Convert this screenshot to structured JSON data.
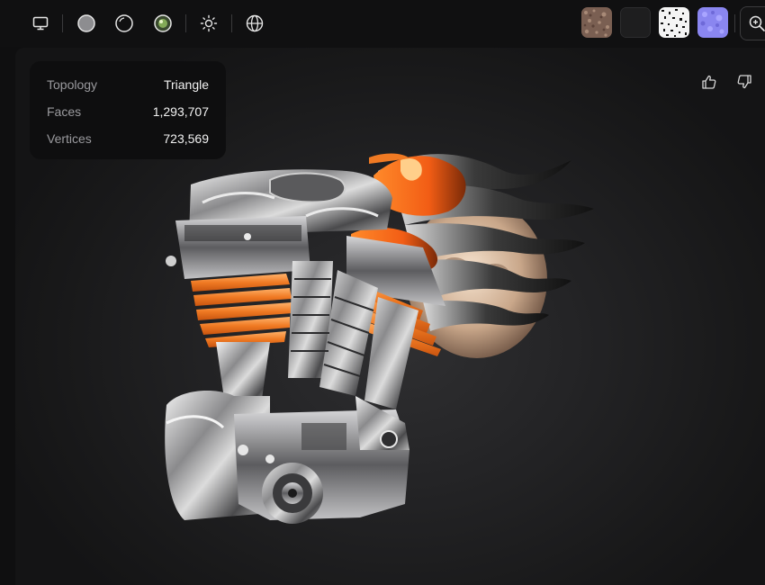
{
  "toolbar": {
    "buttons": [
      {
        "name": "display-mode-button",
        "icon": "monitor-icon"
      },
      {
        "name": "solid-material-button",
        "icon": "filled-sphere-icon"
      },
      {
        "name": "wireframe-material-button",
        "icon": "outline-sphere-icon"
      },
      {
        "name": "clay-material-button",
        "icon": "green-sphere-icon"
      },
      {
        "name": "lighting-button",
        "icon": "sun-icon"
      },
      {
        "name": "environment-button",
        "icon": "globe-icon"
      }
    ],
    "texture_maps": [
      {
        "name": "base-color-texture-thumbnail",
        "icon": "base-color-icon"
      },
      {
        "name": "roughness-texture-thumbnail",
        "icon": "dark-map-icon"
      },
      {
        "name": "noise-texture-thumbnail",
        "icon": "noise-map-icon"
      },
      {
        "name": "normal-texture-thumbnail",
        "icon": "normal-map-icon",
        "color": "#8a86f0"
      }
    ],
    "zoom": {
      "icon": "zoom-in-icon"
    }
  },
  "stats": {
    "topology_label": "Topology",
    "topology_value": "Triangle",
    "faces_label": "Faces",
    "faces_value": "1,293,707",
    "vertices_label": "Vertices",
    "vertices_value": "723,569"
  },
  "feedback": {
    "like_icon": "thumbs-up-icon",
    "dislike_icon": "thumbs-down-icon"
  },
  "colors": {
    "accent_green": "#9ccc65",
    "flame_orange": "#f07a23",
    "chrome": "#c9c9c9"
  }
}
